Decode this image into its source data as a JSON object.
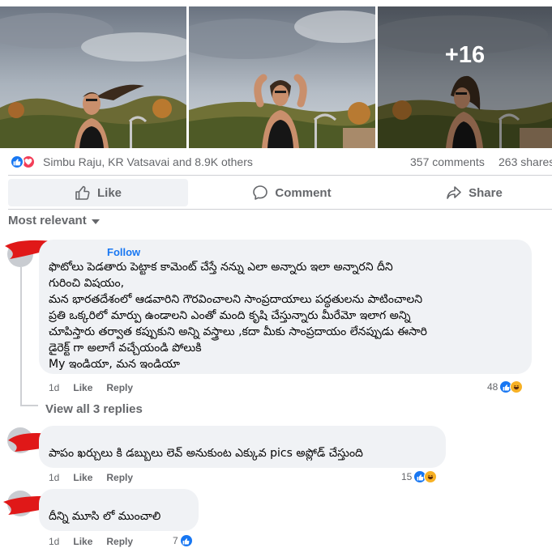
{
  "photos": {
    "more_count": "+16"
  },
  "summary": {
    "reactors": "Simbu Raju, KR Vatsavai and 8.9K others",
    "comments": "357 comments",
    "shares": "263 shares"
  },
  "actions": {
    "like": "Like",
    "comment": "Comment",
    "share": "Share"
  },
  "sort": {
    "label": "Most relevant"
  },
  "comments": [
    {
      "author_visible": "Follow",
      "text": "ఫొటోలు పెడతారు పెట్టాక కామెంట్ చేస్తే నన్ను ఎలా అన్నారు ఇలా అన్నారని దీని\nగురించి విషయం,\nమన భారతదేశంలో ఆడవారిని గౌరవించాలని సాంప్రదాయాలు పద్ధతులను పాటించాలని\nప్రతి ఒక్కరిలో మార్పు ఉండాలని ఎంతో మంది కృషి చేస్తున్నారు మీరేమో ఇలాగ అన్ని\nచూపిస్తారు తర్వాత కప్పుకుని అన్ని వస్త్రాలు ,కదా మీకు సాంప్రదాయం లేనప్పుడు ఈసారి\nడైరెక్ట్ గా అలాగే వచ్చేయండి పోలుకి\nMy ఇండియా, మన ఇండియా",
      "time": "1d",
      "like": "Like",
      "reply": "Reply",
      "reactions": "48"
    },
    {
      "text": "పాపం ఖర్చులు కి డబ్బులు లెవ్ అనుకుంట ఎక్కువ pics అప్లోడ్ చేస్తుంది",
      "time": "1d",
      "like": "Like",
      "reply": "Reply",
      "reactions": "15"
    },
    {
      "text": "దీన్ని మూసి లో ముంచాలి",
      "time": "1d",
      "like": "Like",
      "reply": "Reply",
      "reactions": "7"
    }
  ],
  "view_replies": "View all 3 replies",
  "colors": {
    "brand_blue": "#1877f2",
    "love_red": "#f33e58",
    "haha_yellow": "#f7b125",
    "redaction_red": "#e01818",
    "muted_text": "#65676b",
    "bubble_bg": "#f0f2f5"
  },
  "icons": {
    "like": "thumbs-up-icon",
    "love": "heart-icon",
    "haha": "laughing-face-icon",
    "comment": "speech-bubble-icon",
    "share": "share-arrow-icon",
    "sort": "caret-down-icon"
  }
}
